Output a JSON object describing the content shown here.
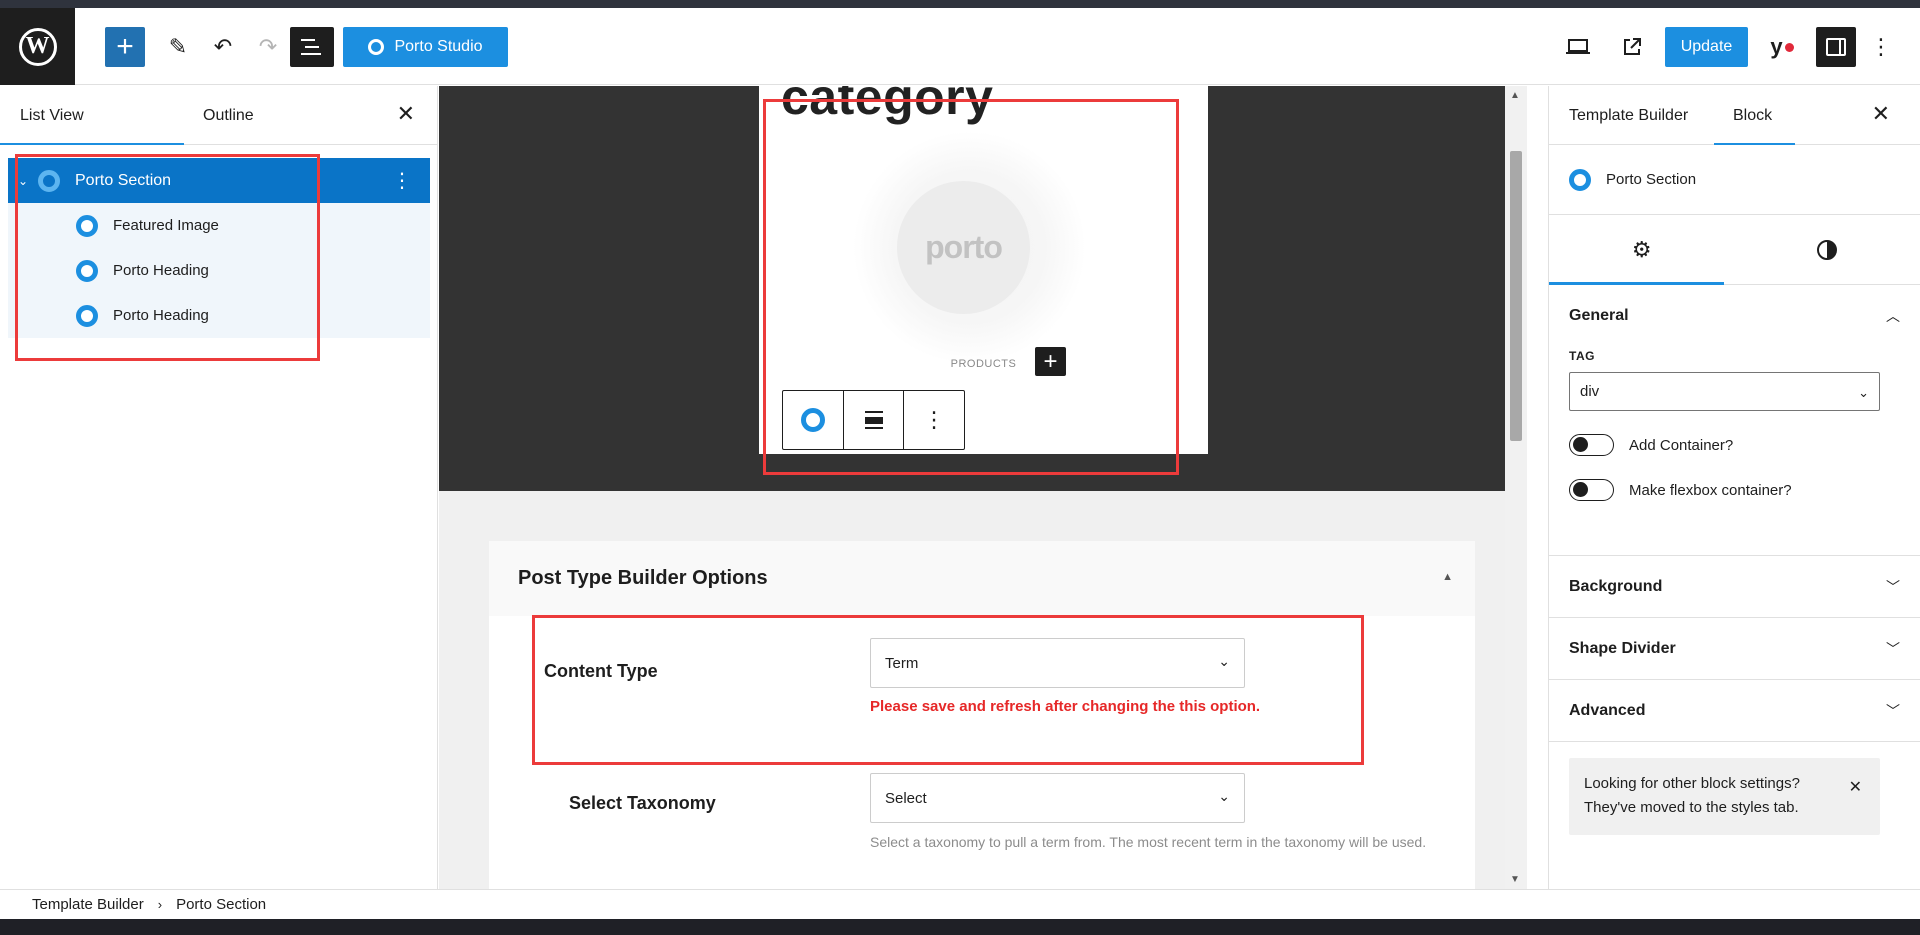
{
  "toolbar": {
    "add_icon": "plus-icon",
    "porto_studio_label": "Porto Studio",
    "update_label": "Update",
    "yoast_label": "y"
  },
  "list_view": {
    "tabs": [
      "List View",
      "Outline"
    ],
    "items": [
      {
        "label": "Porto Section",
        "selected": true
      },
      {
        "label": "Featured Image"
      },
      {
        "label": "Porto Heading"
      },
      {
        "label": "Porto Heading"
      }
    ]
  },
  "canvas": {
    "heading": "category",
    "logo_text": "porto",
    "products_label": "PRODUCTS"
  },
  "options": {
    "title": "Post Type Builder Options",
    "content_type_label": "Content Type",
    "content_type_value": "Term",
    "warning": "Please save and refresh after changing the this option.",
    "taxonomy_label": "Select Taxonomy",
    "taxonomy_value": "Select",
    "taxonomy_help": "Select a taxonomy to pull a term from. The most recent term in the taxonomy will be used."
  },
  "settings": {
    "tabs": [
      "Template Builder",
      "Block"
    ],
    "block_name": "Porto Section",
    "general_title": "General",
    "tag_label": "TAG",
    "tag_value": "div",
    "add_container_label": "Add Container?",
    "flexbox_label": "Make flexbox container?",
    "sections": [
      "Background",
      "Shape Divider",
      "Advanced"
    ],
    "notice_line1": "Looking for other block settings?",
    "notice_line2": "They've moved to the styles tab."
  },
  "breadcrumb": [
    "Template Builder",
    "Porto Section"
  ],
  "colors": {
    "accent": "#1c8fe0",
    "selected_row": "#0a74c7",
    "highlight_box": "#ec3b3b",
    "warning_text": "#e62828"
  }
}
